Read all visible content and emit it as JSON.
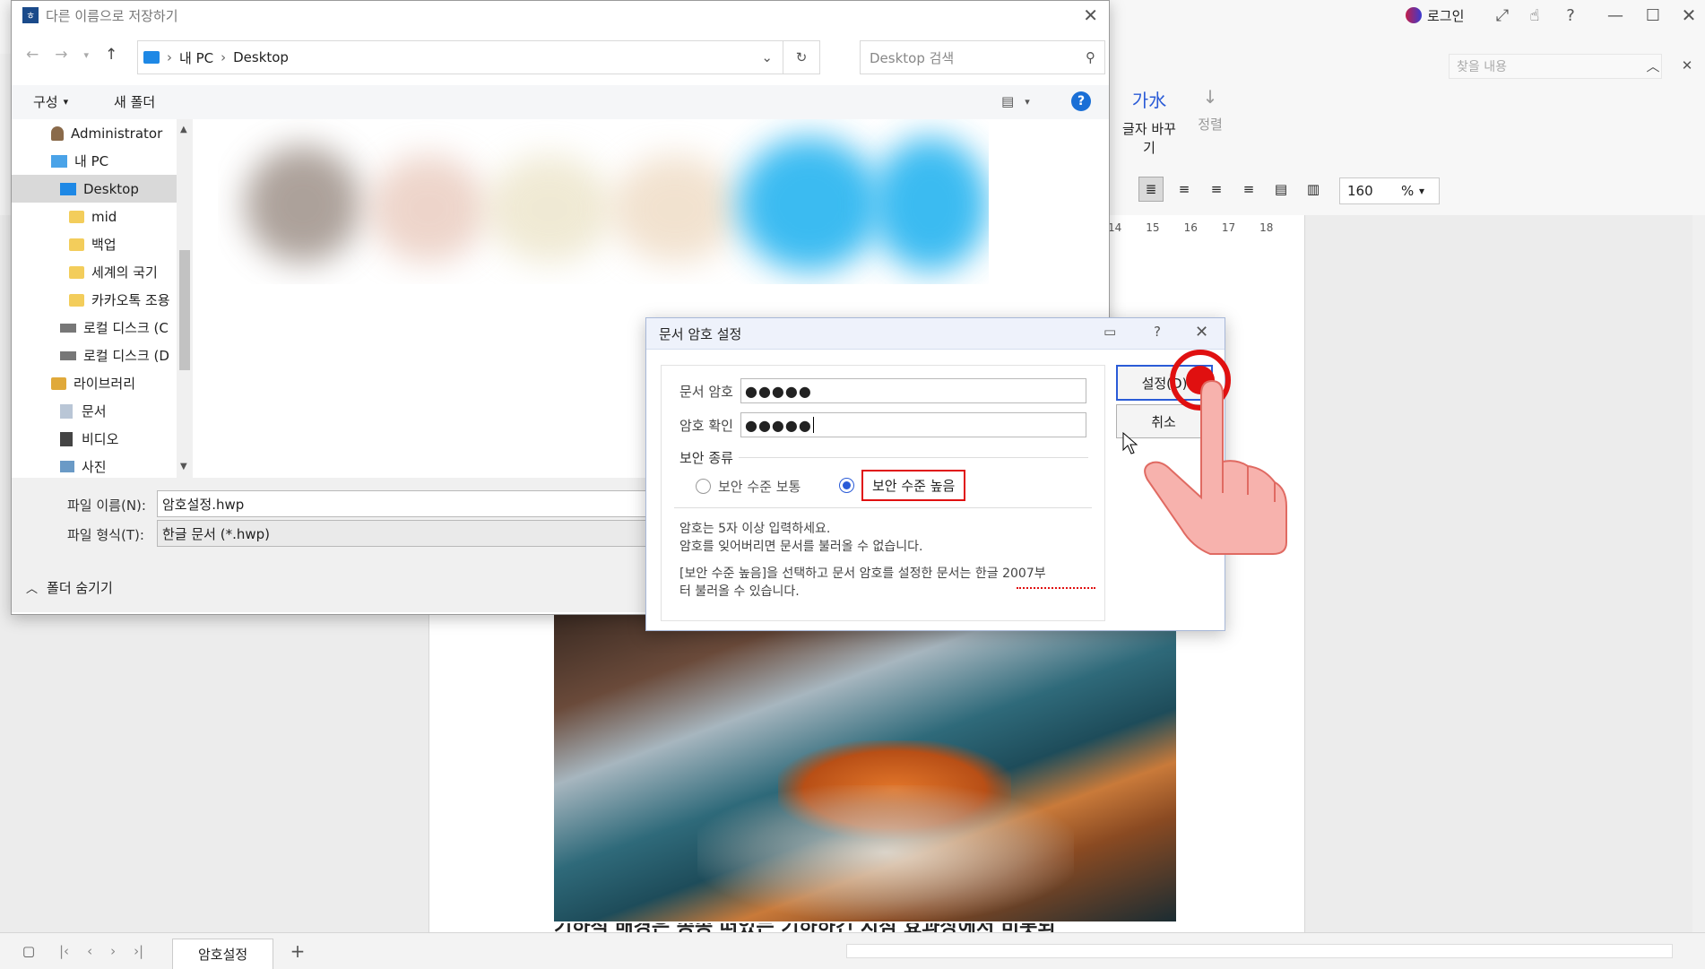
{
  "app": {
    "login_label": "로그인",
    "find_placeholder": "찾을 내용",
    "ribbon": {
      "char_replace_label": "글자 바꾸기",
      "arrange_label": "정렬",
      "zoom_value": "160",
      "zoom_unit": "%"
    },
    "ruler_ticks": [
      "14",
      "15",
      "16",
      "17",
      "18"
    ],
    "doc_text": "기하적 배경은 종종 떠있는 기하하긴 지점 효과상에서 비롯되",
    "tab_label": "암호설정"
  },
  "save_dialog": {
    "title": "다른 이름으로 저장하기",
    "address": [
      "내 PC",
      "Desktop"
    ],
    "search_placeholder": "Desktop 검색",
    "organize_label": "구성",
    "new_folder_label": "새 폴더",
    "nav_items": [
      {
        "label": "Administrator",
        "type": "user"
      },
      {
        "label": "내 PC",
        "type": "pc"
      },
      {
        "label": "Desktop",
        "type": "desktop",
        "selected": true
      },
      {
        "label": "mid",
        "type": "folder"
      },
      {
        "label": "백업",
        "type": "folder"
      },
      {
        "label": "세계의 국기",
        "type": "folder"
      },
      {
        "label": "카카오톡 조용",
        "type": "folder"
      },
      {
        "label": "로컬 디스크 (C",
        "type": "drive"
      },
      {
        "label": "로컬 디스크 (D",
        "type": "drive"
      },
      {
        "label": "라이브러리",
        "type": "library"
      },
      {
        "label": "문서",
        "type": "docs"
      },
      {
        "label": "비디오",
        "type": "video"
      },
      {
        "label": "사진",
        "type": "photo"
      }
    ],
    "filename_label": "파일 이름(N):",
    "filename_value": "암호설정.hwp",
    "filetype_label": "파일 형식(T):",
    "filetype_value": "한글 문서 (*.hwp)",
    "hide_folders_label": "폴더 숨기기"
  },
  "password_dialog": {
    "title": "문서 암호 설정",
    "password_label": "문서 암호",
    "password_value": "●●●●●",
    "confirm_label": "암호 확인",
    "confirm_value": "●●●●●",
    "security_type_label": "보안 종류",
    "option_normal": "보안 수준 보통",
    "option_high": "보안 수준 높음",
    "selected_option": "high",
    "info_line1": "암호는 5자 이상 입력하세요.",
    "info_line2": "암호를 잊어버리면 문서를 불러올 수 없습니다.",
    "info_line3": "[보안 수준 높음]을 선택하고 문서 암호를 설정한 문서는 한글 2007부",
    "info_line4": "터 불러올 수 있습니다.",
    "set_button": "설정(D)",
    "cancel_button": "취소"
  },
  "colors": {
    "highlight_red": "#e01010",
    "accent_blue": "#2a5bd7",
    "selection": "#cce4f7"
  }
}
